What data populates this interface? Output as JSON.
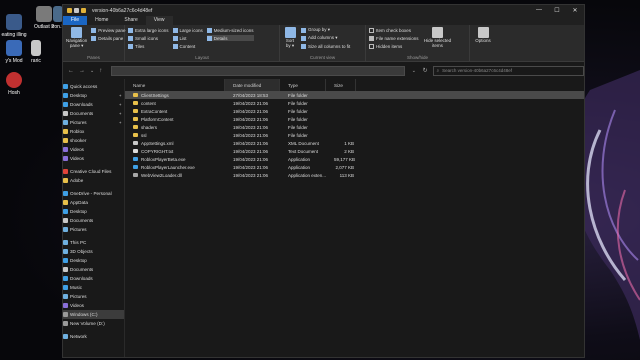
{
  "window": {
    "title": "version-40b6a27c6c4d48ef",
    "controls": {
      "minimize": "—",
      "maximize": "☐",
      "close": "✕"
    }
  },
  "tabs": [
    {
      "label": "File"
    },
    {
      "label": "Home"
    },
    {
      "label": "Share"
    },
    {
      "label": "View"
    }
  ],
  "ribbon": {
    "panes": {
      "label": "Panes",
      "navigation_pane": "Navigation pane ▾",
      "preview_pane": "Preview pane",
      "details_pane": "Details pane"
    },
    "layout": {
      "label": "Layout",
      "items": [
        "Extra large icons",
        "Large icons",
        "Medium-sized icons",
        "Small icons",
        "List",
        "Details",
        "Tiles",
        "Content"
      ]
    },
    "current_view": {
      "label": "Current view",
      "sort_by": "Sort by ▾",
      "group_by": "Group by ▾",
      "add_columns": "Add columns ▾",
      "size_columns": "Size all columns to fit"
    },
    "show_hide": {
      "label": "Show/hide",
      "item_check_boxes": "Item check boxes",
      "file_name_extensions": "File name extensions",
      "hidden_items": "Hidden items",
      "hide_selected": "Hide selected items"
    },
    "options": "Options"
  },
  "navbar": {
    "search_placeholder": "Search version-40b6a27c6c4d48ef"
  },
  "sidebar": [
    {
      "label": "Quick access",
      "color": "#3fa0e6"
    },
    {
      "label": "Desktop",
      "color": "#3fa0e6",
      "pinned": true
    },
    {
      "label": "Downloads",
      "color": "#3fa0e6",
      "pinned": true
    },
    {
      "label": "Documents",
      "color": "#c8c8c8",
      "pinned": true
    },
    {
      "label": "Pictures",
      "color": "#6fb0e0",
      "pinned": true
    },
    {
      "label": "Roblox",
      "color": "#e8c04a"
    },
    {
      "label": "shooker",
      "color": "#e8c04a"
    },
    {
      "label": "Videos",
      "color": "#8a6fd8"
    },
    {
      "label": "Videos",
      "color": "#8a6fd8"
    },
    {
      "label": "Creative Cloud Files",
      "color": "#e0443a",
      "gap": true
    },
    {
      "label": "Adobe",
      "color": "#e8c04a"
    },
    {
      "label": "OneDrive - Personal",
      "color": "#3fa0e6",
      "gap": true
    },
    {
      "label": "AppData",
      "color": "#e8c04a"
    },
    {
      "label": "Desktop",
      "color": "#3fa0e6"
    },
    {
      "label": "Documents",
      "color": "#c8c8c8"
    },
    {
      "label": "Pictures",
      "color": "#6fb0e0"
    },
    {
      "label": "This PC",
      "color": "#6fb0e0",
      "gap": true
    },
    {
      "label": "3D Objects",
      "color": "#6fb0e0"
    },
    {
      "label": "Desktop",
      "color": "#3fa0e6"
    },
    {
      "label": "Documents",
      "color": "#c8c8c8"
    },
    {
      "label": "Downloads",
      "color": "#3fa0e6"
    },
    {
      "label": "Music",
      "color": "#3fa0e6"
    },
    {
      "label": "Pictures",
      "color": "#6fb0e0"
    },
    {
      "label": "Videos",
      "color": "#8a6fd8"
    },
    {
      "label": "Windows (C:)",
      "color": "#9a9a9a",
      "selected": true
    },
    {
      "label": "New Volume (D:)",
      "color": "#9a9a9a"
    },
    {
      "label": "Network",
      "color": "#6fb0e0",
      "gap": true
    }
  ],
  "columns": {
    "name": "Name",
    "date": "Date modified",
    "type": "Type",
    "size": "Size"
  },
  "files": [
    {
      "name": "ClientSettings",
      "date": "27/04/2023 18:53",
      "type": "File folder",
      "size": "",
      "icon": "folder",
      "selected": true
    },
    {
      "name": "content",
      "date": "19/04/2023 21:06",
      "type": "File folder",
      "size": "",
      "icon": "folder"
    },
    {
      "name": "ExtraContent",
      "date": "19/04/2023 21:06",
      "type": "File folder",
      "size": "",
      "icon": "folder"
    },
    {
      "name": "PlatformContent",
      "date": "19/04/2023 21:06",
      "type": "File folder",
      "size": "",
      "icon": "folder"
    },
    {
      "name": "shaders",
      "date": "19/04/2023 21:06",
      "type": "File folder",
      "size": "",
      "icon": "folder"
    },
    {
      "name": "ssl",
      "date": "19/04/2023 21:06",
      "type": "File folder",
      "size": "",
      "icon": "folder"
    },
    {
      "name": "AppSettings.xml",
      "date": "19/04/2023 21:06",
      "type": "XML Document",
      "size": "1 KB",
      "icon": "xml"
    },
    {
      "name": "COPYRIGHT.txt",
      "date": "19/04/2023 21:06",
      "type": "Text Document",
      "size": "2 KB",
      "icon": "txt"
    },
    {
      "name": "RobloxPlayerBeta.exe",
      "date": "19/04/2023 21:06",
      "type": "Application",
      "size": "59,177 KB",
      "icon": "exe"
    },
    {
      "name": "RobloxPlayerLauncher.exe",
      "date": "19/04/2023 21:06",
      "type": "Application",
      "size": "2,077 KB",
      "icon": "exe"
    },
    {
      "name": "WebView2Loader.dll",
      "date": "19/04/2023 21:06",
      "type": "Application exten...",
      "size": "113 KB",
      "icon": "dll"
    }
  ],
  "desktop_icons": [
    {
      "label": "Outlast 2",
      "color": "#7a7a7a"
    },
    {
      "label": "tron.S",
      "color": "#4a6a8a"
    },
    {
      "label": "eating illing",
      "color": "#3a5a8a"
    },
    {
      "label": "y's Mod",
      "color": "#3a6ab8"
    },
    {
      "label": "raric",
      "color": "#c8c8c8"
    },
    {
      "label": "Hosh",
      "color": "#c03030"
    }
  ]
}
